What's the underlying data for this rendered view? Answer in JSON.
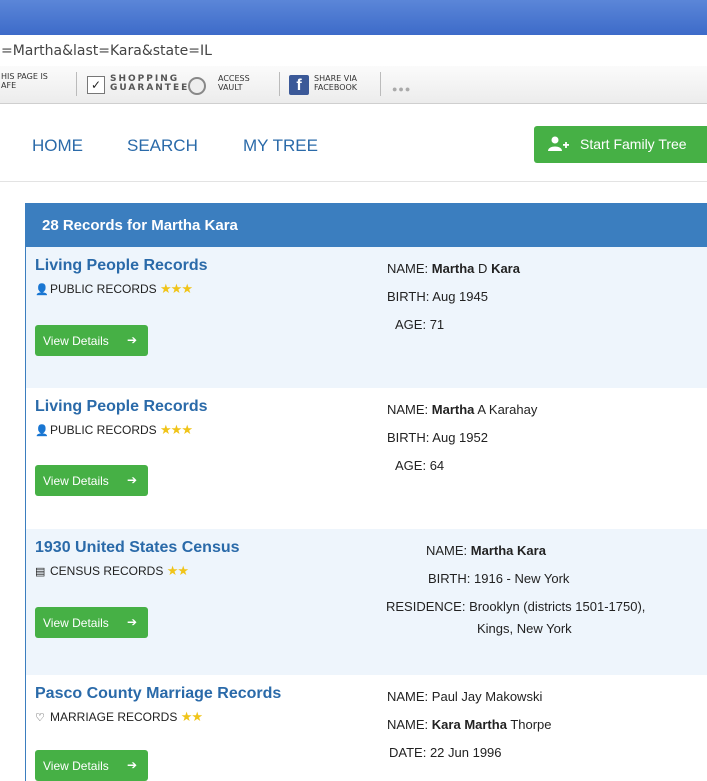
{
  "browser": {
    "url": "=Martha&last=Kara&state=IL"
  },
  "toolbar": {
    "safe_line1": "HIS PAGE IS",
    "safe_line2": "AFE",
    "shopping_line1": "SHOPPING",
    "shopping_line2": "GUARANTEE",
    "vault_line1": "ACCESS",
    "vault_line2": "VAULT",
    "share_line1": "SHARE VIA",
    "share_line2": "FACEBOOK",
    "more": "●●●"
  },
  "nav": {
    "home": "HOME",
    "search": "SEARCH",
    "mytree": "MY TREE",
    "start_button": "Start Family Tree"
  },
  "results": {
    "header": "28 Records for Martha Kara",
    "view_details_label": "View Details",
    "records": [
      {
        "title": "Living People Records",
        "category": "PUBLIC RECORDS",
        "stars": "★★★",
        "name_label": "NAME:",
        "name_first": "Martha",
        "name_middle": "D",
        "name_last": "Kara",
        "birth_label": "BIRTH:",
        "birth": "Aug 1945",
        "age_label": "AGE:",
        "age": "71"
      },
      {
        "title": "Living People Records",
        "category": "PUBLIC RECORDS",
        "stars": "★★★",
        "name_label": "NAME:",
        "name_first": "Martha",
        "name_rest": "A Karahay",
        "birth_label": "BIRTH:",
        "birth": "Aug 1952",
        "age_label": "AGE:",
        "age": "64"
      },
      {
        "title": "1930 United States Census",
        "category": "CENSUS RECORDS",
        "stars": "★★",
        "name_label": "NAME:",
        "name": "Martha Kara",
        "birth_label": "BIRTH:",
        "birth": "1916 - New York",
        "residence_label": "RESIDENCE:",
        "residence_line1": "Brooklyn (districts 1501-1750),",
        "residence_line2": "Kings, New York"
      },
      {
        "title": "Pasco County Marriage Records",
        "category": "MARRIAGE RECORDS",
        "stars": "★★",
        "name_label": "NAME:",
        "name1": "Paul Jay Makowski",
        "name2_bold": "Kara Martha",
        "name2_rest": "Thorpe",
        "date_label": "DATE:",
        "date": "22 Jun 1996"
      }
    ]
  },
  "icons": {
    "person": "person-icon",
    "census": "census-icon",
    "heart": "heart-icon",
    "arrow": "arrow-right-icon",
    "add_user": "add-user-icon"
  },
  "colors": {
    "accent_blue": "#3b7ebf",
    "link_blue": "#2a6aa9",
    "button_green": "#46b045",
    "star_gold": "#f0c419",
    "alt_row": "#eef5fc"
  }
}
